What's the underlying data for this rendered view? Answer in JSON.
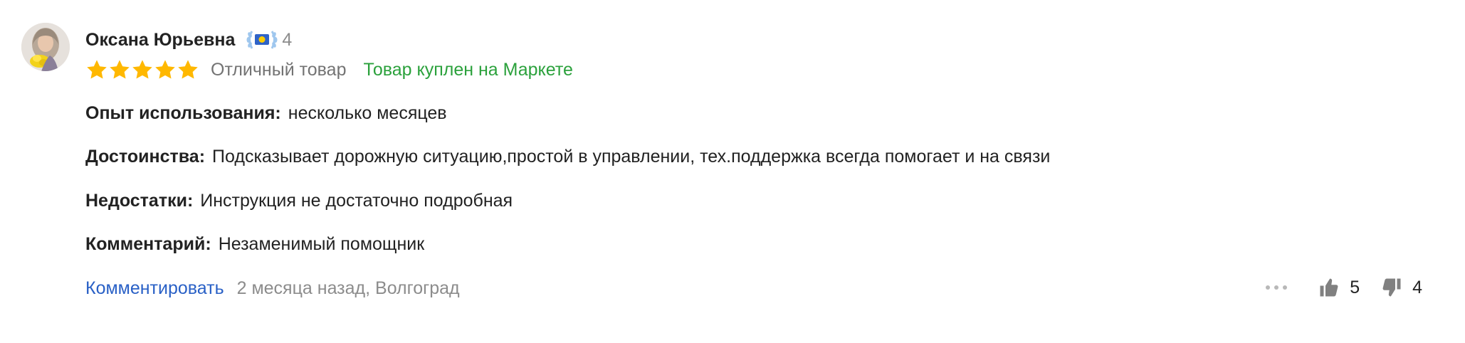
{
  "review": {
    "author": "Оксана Юрьевна",
    "badge": {
      "icon": "laurel-badge-icon",
      "count": "4"
    },
    "rating": {
      "stars": 5,
      "max": 5,
      "text": "Отличный товар",
      "star_color": "#ffb800"
    },
    "purchased": "Товар куплен на Маркете",
    "sections": [
      {
        "label": "Опыт использования:",
        "value": "несколько месяцев"
      },
      {
        "label": "Достоинства:",
        "value": "Подсказывает дорожную ситуацию,простой в управлении, тех.поддержка всегда помогает и на связи"
      },
      {
        "label": "Недостатки:",
        "value": "Инструкция не достаточно подробная"
      },
      {
        "label": "Комментарий:",
        "value": "Незаменимый помощник"
      }
    ],
    "footer": {
      "comment_label": "Комментировать",
      "meta": "2 месяца назад, Волгоград"
    },
    "votes": {
      "likes": "5",
      "dislikes": "4"
    }
  },
  "colors": {
    "link": "#2960c6",
    "purchased": "#2ba13c",
    "muted": "#8c8c8c"
  }
}
